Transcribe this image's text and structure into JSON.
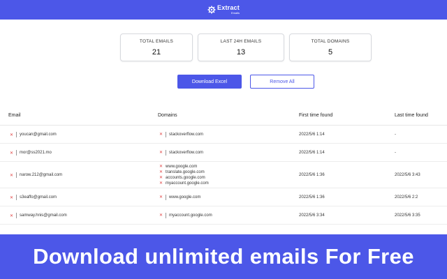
{
  "header": {
    "logo_main": "Extract",
    "logo_sub": "Emails"
  },
  "stats": [
    {
      "label": "TOTAL EMAILS",
      "value": "21"
    },
    {
      "label": "LAST 24H EMAILS",
      "value": "13"
    },
    {
      "label": "TOTAL DOMAINS",
      "value": "5"
    }
  ],
  "buttons": {
    "download": "Download Excel",
    "remove": "Remove All"
  },
  "table": {
    "headers": [
      "Email",
      "Domains",
      "First time found",
      "Last time found"
    ],
    "rows": [
      {
        "email": "youcan@gmail.com",
        "domains": [
          "stackoverflow.com"
        ],
        "first": "2022/5/6 1:14",
        "last": "-"
      },
      {
        "email": "mor@ss2021.mo",
        "domains": [
          "stackoverflow.com"
        ],
        "first": "2022/5/6 1:14",
        "last": "-"
      },
      {
        "email": "narow.212@gmail.com",
        "domains": [
          "www.google.com",
          "translate.google.com",
          "accounts.google.com",
          "myaccount.google.com"
        ],
        "first": "2022/5/6 1:36",
        "last": "2022/5/6 3:43"
      },
      {
        "email": "s3eaffo@gmail.com",
        "domains": [
          "www.google.com"
        ],
        "first": "2022/5/6 1:36",
        "last": "2022/5/6 2:2"
      },
      {
        "email": "samway.hnis@gmail.com",
        "domains": [
          "myaccount.google.com"
        ],
        "first": "2022/5/6 3:34",
        "last": "2022/5/6 3:35"
      }
    ]
  },
  "banner": {
    "text": "Download unlimited emails For Free"
  },
  "colors": {
    "accent": "#4c57e8",
    "remove_icon": "#e04040"
  }
}
